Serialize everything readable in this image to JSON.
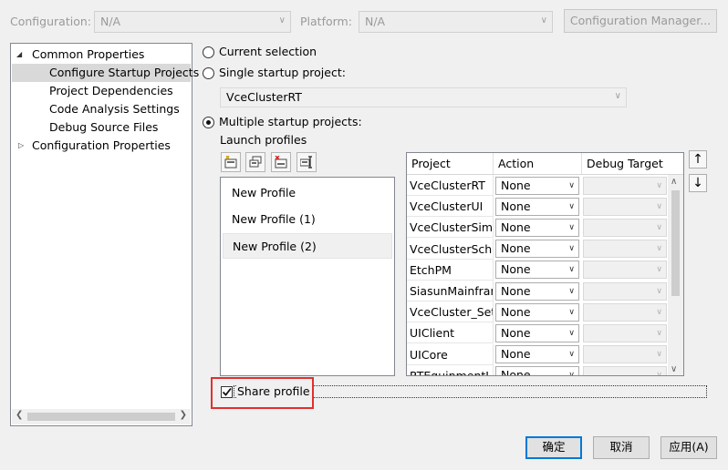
{
  "config": {
    "configuration_label": "Configuration:",
    "configuration_value": "N/A",
    "platform_label": "Platform:",
    "platform_value": "N/A",
    "manager_button": "Configuration Manager..."
  },
  "tree": {
    "common": "Common Properties",
    "items": [
      "Configure Startup Projects",
      "Project Dependencies",
      "Code Analysis Settings",
      "Debug Source Files"
    ],
    "configuration": "Configuration Properties"
  },
  "startup": {
    "current_selection": "Current selection",
    "single_project": "Single startup project:",
    "single_value": "VceClusterRT",
    "multiple_projects": "Multiple startup projects:",
    "launch_profiles": "Launch profiles"
  },
  "profiles": [
    "New Profile",
    "New Profile (1)",
    "New Profile (2)"
  ],
  "grid": {
    "headers": [
      "Project",
      "Action",
      "Debug Target"
    ],
    "rows": [
      {
        "project": "VceClusterRT",
        "action": "None"
      },
      {
        "project": "VceClusterUI",
        "action": "None"
      },
      {
        "project": "VceClusterSimu",
        "action": "None"
      },
      {
        "project": "VceClusterSche",
        "action": "None"
      },
      {
        "project": "EtchPM",
        "action": "None"
      },
      {
        "project": "SiasunMainfram",
        "action": "None"
      },
      {
        "project": "VceCluster_Setu",
        "action": "None"
      },
      {
        "project": "UIClient",
        "action": "None"
      },
      {
        "project": "UICore",
        "action": "None"
      },
      {
        "project": "RTEquipmentLi",
        "action": "None"
      }
    ]
  },
  "share_profile": "Share profile",
  "buttons": {
    "ok": "确定",
    "cancel": "取消",
    "apply": "应用(A)"
  },
  "icons": {
    "move_up": "↑",
    "move_down": "↓"
  },
  "colors": {
    "highlight": "#e03030",
    "accent": "#0078d7"
  }
}
